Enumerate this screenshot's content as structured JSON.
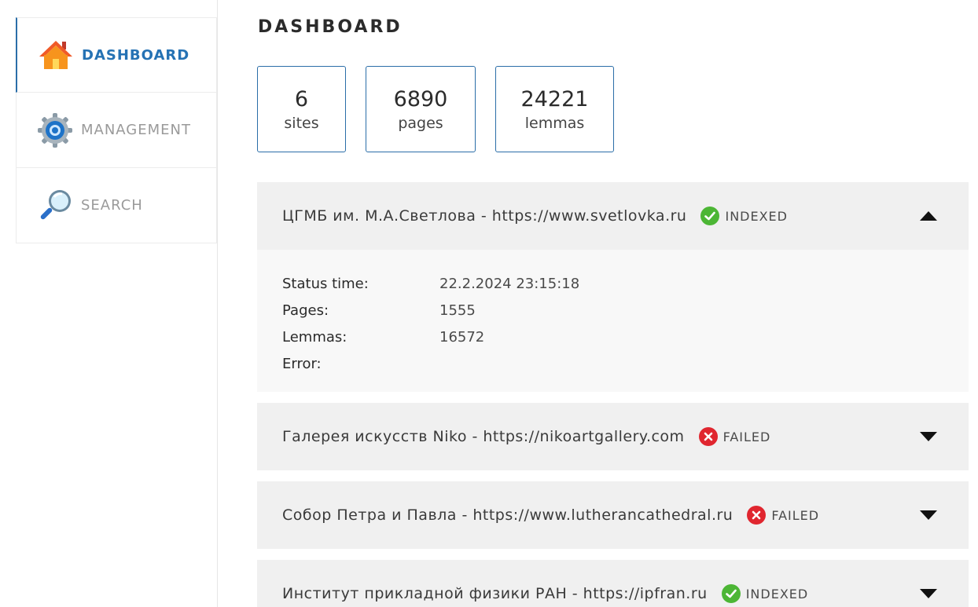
{
  "sidebar": {
    "items": [
      {
        "label": "DASHBOARD",
        "icon": "home-icon",
        "active": true
      },
      {
        "label": "MANAGEMENT",
        "icon": "gear-icon",
        "active": false
      },
      {
        "label": "SEARCH",
        "icon": "magnifier-icon",
        "active": false
      }
    ]
  },
  "main": {
    "title": "DASHBOARD",
    "stats": [
      {
        "value": "6",
        "label": "sites"
      },
      {
        "value": "6890",
        "label": "pages"
      },
      {
        "value": "24221",
        "label": "lemmas"
      }
    ],
    "sites": [
      {
        "name": "ЦГМБ им. М.А.Светлова - https://www.svetlovka.ru",
        "status": "INDEXED",
        "expanded": true,
        "details": {
          "status_time_label": "Status time:",
          "status_time": "22.2.2024 23:15:18",
          "pages_label": "Pages:",
          "pages": "1555",
          "lemmas_label": "Lemmas:",
          "lemmas": "16572",
          "error_label": "Error:",
          "error": ""
        }
      },
      {
        "name": "Галерея искусств Niko - https://nikoartgallery.com",
        "status": "FAILED",
        "expanded": false
      },
      {
        "name": "Собор Петра и Павла - https://www.lutherancathedral.ru",
        "status": "FAILED",
        "expanded": false
      },
      {
        "name": "Институт прикладной физики РАН - https://ipfran.ru",
        "status": "INDEXED",
        "expanded": false
      }
    ]
  },
  "colors": {
    "accent": "#2572b4",
    "indexed": "#4cb635",
    "failed": "#e0262f",
    "panel": "#f0f0f0"
  }
}
